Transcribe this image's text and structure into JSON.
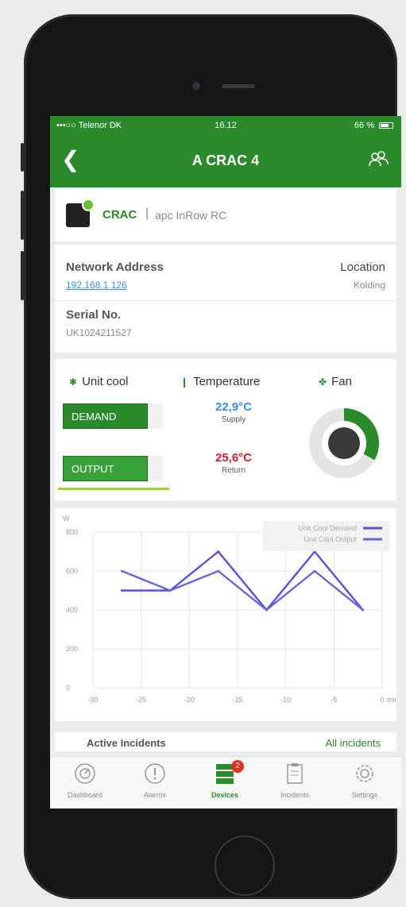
{
  "status_bar": {
    "carrier": "•••○○ Telenor DK",
    "time": "16.12",
    "battery": "66 %"
  },
  "nav": {
    "title": "A CRAC 4",
    "back_icon": "chevron-left-icon",
    "right_icon": "users-icon"
  },
  "device": {
    "type": "CRAC",
    "separator": "|",
    "model": "apc InRow RC",
    "network_address_label": "Network Address",
    "network_address": "192.168.1.126",
    "location_label": "Location",
    "location": "Kolding",
    "serial_label": "Serial No.",
    "serial": "UK1024211527"
  },
  "metrics": {
    "unit_cool_label": "Unit cool",
    "temperature_label": "Temperature",
    "fan_label": "Fan",
    "demand_label": "DEMAND",
    "output_label": "OUTPUT",
    "demand_fraction": 0.85,
    "output_fraction": 0.85,
    "supply_temp": "22,9°C",
    "supply_label": "Supply",
    "return_temp": "25,6°C",
    "return_label": "Return",
    "fan_speed_fraction": 0.33,
    "colors": {
      "supply": "#3a8ee6",
      "return": "#d0202a",
      "green": "#2b8a2b"
    }
  },
  "chart_data": {
    "type": "line",
    "ylabel": "W",
    "xlabel": "mins",
    "x": [
      -27,
      -22,
      -17,
      -12,
      -7,
      -2
    ],
    "x_ticks": [
      "-30",
      "-25",
      "-20",
      "-15",
      "-10",
      "-5",
      "0"
    ],
    "y_ticks": [
      "0",
      "200",
      "400",
      "600",
      "800"
    ],
    "xlim": [
      -30,
      0
    ],
    "ylim": [
      0,
      800
    ],
    "grid": true,
    "legend": "top-right",
    "series": [
      {
        "name": "Unit Cool Demand",
        "values": [
          500,
          500,
          700,
          400,
          700,
          400
        ],
        "color": "#5a4fd8"
      },
      {
        "name": "Unit Cool Output",
        "values": [
          600,
          500,
          600,
          400,
          600,
          400
        ],
        "color": "#6a63e0"
      }
    ]
  },
  "incidents": {
    "label": "Active Incidents",
    "link": "All incidents"
  },
  "tabs": [
    {
      "label": "Dashboard",
      "icon": "dashboard-icon"
    },
    {
      "label": "Alarms",
      "icon": "alarm-icon"
    },
    {
      "label": "Devices",
      "icon": "devices-icon",
      "badge": "2",
      "active": true
    },
    {
      "label": "Incidents",
      "icon": "incidents-icon"
    },
    {
      "label": "Settings",
      "icon": "settings-icon"
    }
  ]
}
